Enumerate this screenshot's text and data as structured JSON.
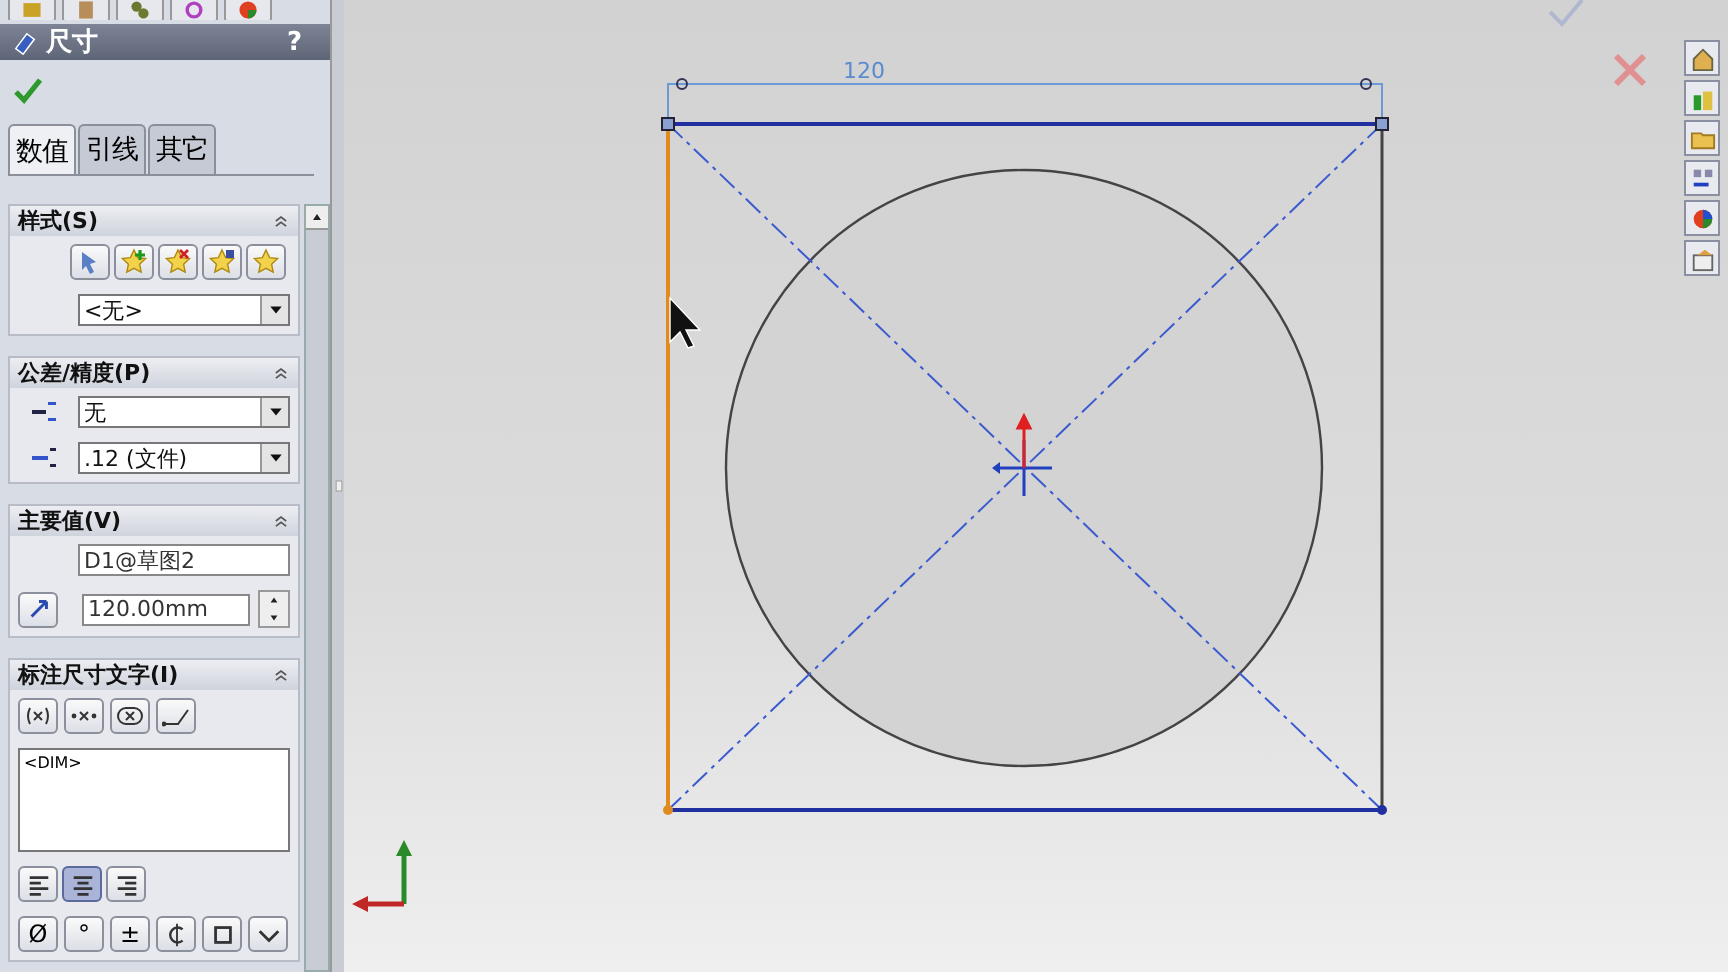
{
  "panel": {
    "title": "尺寸",
    "help": "?",
    "tabs": [
      {
        "label": "数值",
        "selected": true
      },
      {
        "label": "引线",
        "selected": false
      },
      {
        "label": "其它",
        "selected": false
      }
    ],
    "sections": [
      {
        "kind": "style",
        "title": "样式(S)",
        "dropdown": "<无>"
      },
      {
        "kind": "tolerance",
        "title": "公差/精度(P)",
        "dropdowns": [
          "无",
          ".12 (文件)"
        ]
      },
      {
        "kind": "primary",
        "title": "主要值(V)",
        "name_field": "D1@草图2",
        "value_field": "120.00mm"
      },
      {
        "kind": "text",
        "title": "标注尺寸文字(I)",
        "text_value": "<DIM>",
        "align": [
          {
            "selected": false
          },
          {
            "selected": true
          },
          {
            "selected": false
          }
        ],
        "symbols": [
          {
            "kind": "char",
            "label": "Ø"
          },
          {
            "kind": "char",
            "label": "°"
          },
          {
            "kind": "char",
            "label": "±"
          },
          {
            "kind": "centerline"
          },
          {
            "kind": "square"
          },
          {
            "kind": "more"
          }
        ]
      }
    ]
  },
  "canvas": {
    "dimension": "120"
  }
}
